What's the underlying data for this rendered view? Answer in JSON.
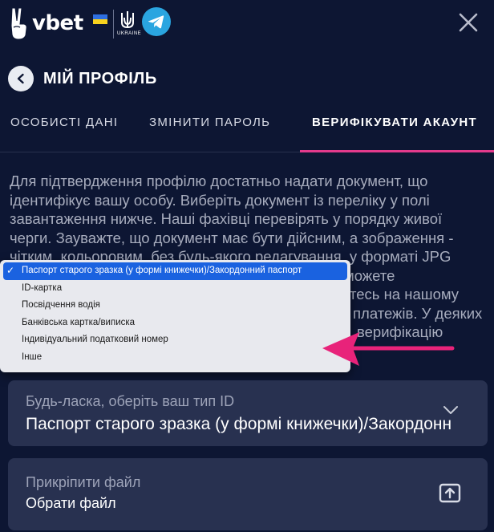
{
  "header": {
    "brand": "vbet",
    "ukraine_label": "UKRAINE",
    "icons": [
      "victory-hand-icon",
      "ukraine-flag-icon",
      "trident-icon",
      "telegram-icon",
      "close-icon"
    ]
  },
  "title_bar": {
    "title": "МІЙ ПРОФІЛЬ",
    "back_icon": "chevron-left-icon"
  },
  "tabs": [
    {
      "label": "ОСОБИСТІ ДАНІ",
      "active": false
    },
    {
      "label": "ЗМІНИТИ ПАРОЛЬ",
      "active": false
    },
    {
      "label": "ВЕРИФІКУВАТИ АКАУНТ",
      "active": true
    }
  ],
  "description": {
    "lines": [
      "Для підтвердження профілю достатньо надати документ, що",
      "ідентифікує вашу особу. Виберіть документ із переліку у полі",
      "завантаження нижче. Наші фахівці перевірять у порядку живої",
      "черги. Зауважте, що документ має бути дійсним, а зображення -",
      "чітким, кольоровим, без будь-якого редагування, у форматі JPG",
      "можете",
      "тесь на нашому",
      "платежів. У деяких",
      "верифікацію"
    ]
  },
  "dropdown": {
    "options": [
      "Паспорт старого зразка (у формі книжечки)/Закордонний паспорт",
      "ID-картка",
      "Посвідчення водія",
      "Банківська картка/виписка",
      "Індивідуальний податковий номер",
      "Інше"
    ],
    "selected_index": 0,
    "check_mark": "✓"
  },
  "id_type_field": {
    "label": "Будь-ласка, оберіть ваш тип ID",
    "value": "Паспорт старого зразка (у формі книжечки)/Закордонний паспорт"
  },
  "file_field": {
    "label": "Прикріпити файл",
    "value": "Обрати файл"
  },
  "colors": {
    "background": "#0d1633",
    "field": "#283150",
    "accent_pink": "#e33a8c",
    "selected_option": "#1a62e0",
    "telegram": "#2aa5e0"
  }
}
